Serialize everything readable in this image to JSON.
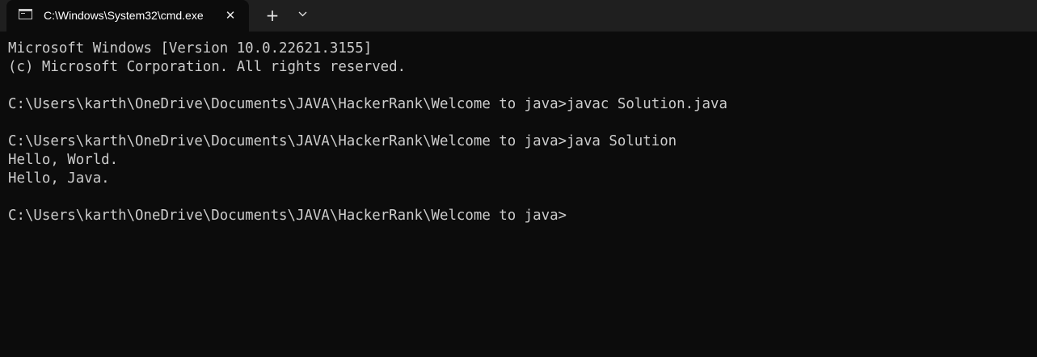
{
  "tab": {
    "title": "C:\\Windows\\System32\\cmd.exe",
    "icon": "cmd-icon",
    "close_glyph": "✕",
    "new_tab_glyph": "+"
  },
  "terminal": {
    "lines": [
      "Microsoft Windows [Version 10.0.22621.3155]",
      "(c) Microsoft Corporation. All rights reserved.",
      "",
      "C:\\Users\\karth\\OneDrive\\Documents\\JAVA\\HackerRank\\Welcome to java>javac Solution.java",
      "",
      "C:\\Users\\karth\\OneDrive\\Documents\\JAVA\\HackerRank\\Welcome to java>java Solution",
      "Hello, World.",
      "Hello, Java.",
      "",
      "C:\\Users\\karth\\OneDrive\\Documents\\JAVA\\HackerRank\\Welcome to java>"
    ]
  },
  "colors": {
    "background": "#0c0c0c",
    "titlebar": "#1f1f1f",
    "text": "#cccccc"
  }
}
